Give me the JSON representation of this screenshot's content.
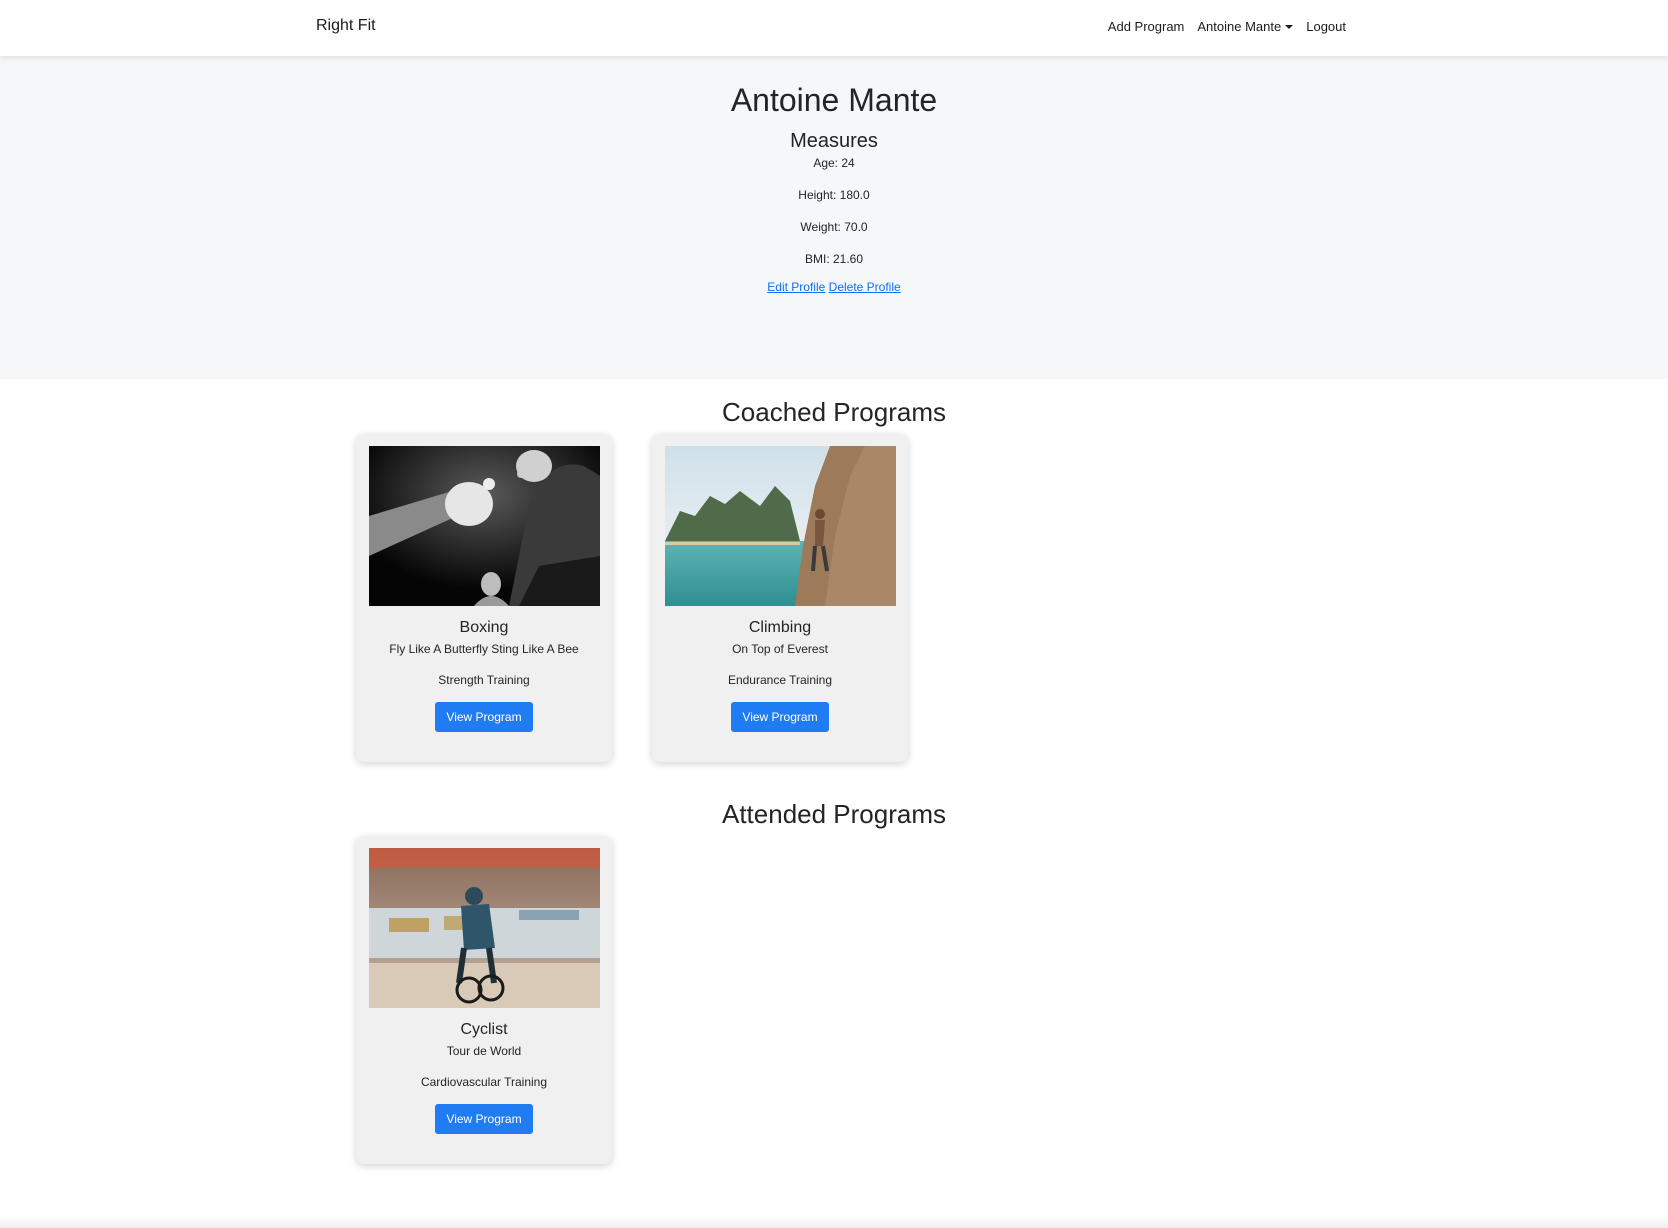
{
  "nav": {
    "brand": "Right Fit",
    "add_program": "Add Program",
    "user_menu": "Antoine Mante",
    "logout": "Logout"
  },
  "profile": {
    "name": "Antoine Mante",
    "measures_title": "Measures",
    "age": "Age: 24",
    "height": "Height: 180.0",
    "weight": "Weight: 70.0",
    "bmi": "BMI: 21.60",
    "edit_link": "Edit Profile",
    "delete_link": "Delete Profile"
  },
  "coached": {
    "title": "Coached Programs",
    "programs": [
      {
        "name": "Boxing",
        "tagline": "Fly Like A Butterfly Sting Like A Bee",
        "type": "Strength Training",
        "button": "View Program",
        "image": "boxing-photo"
      },
      {
        "name": "Climbing",
        "tagline": "On Top of Everest",
        "type": "Endurance Training",
        "button": "View Program",
        "image": "climbing-photo"
      }
    ]
  },
  "attended": {
    "title": "Attended Programs",
    "programs": [
      {
        "name": "Cyclist",
        "tagline": "Tour de World",
        "type": "Cardiovascular Training",
        "button": "View Program",
        "image": "cycling-photo"
      }
    ]
  }
}
